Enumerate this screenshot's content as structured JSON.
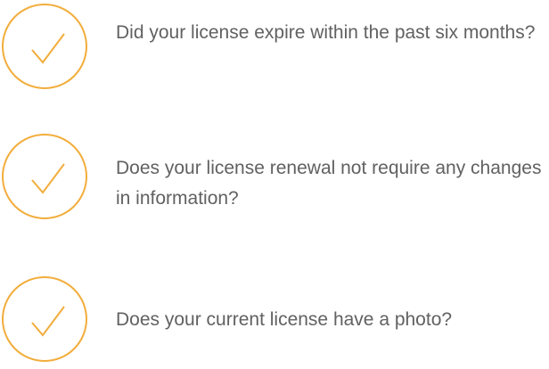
{
  "accent_color": "#f2ad3c",
  "text_color": "#616161",
  "checklist": {
    "items": [
      {
        "text": "Did your license expire within the past six months?",
        "icon": "check-icon"
      },
      {
        "text": "Does your license renewal not require any changes in information?",
        "icon": "check-icon"
      },
      {
        "text": "Does your current license have a photo?",
        "icon": "check-icon"
      }
    ]
  }
}
